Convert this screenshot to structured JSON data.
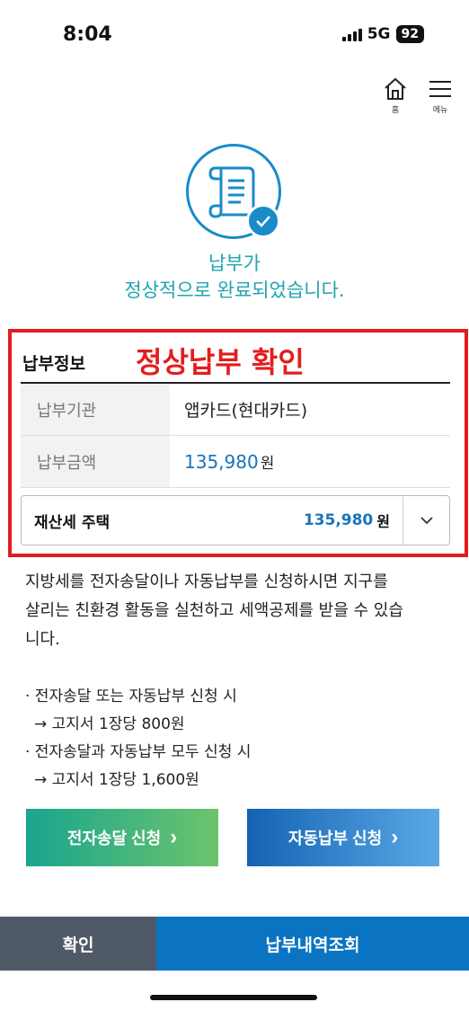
{
  "status": {
    "time": "8:04",
    "network": "5G",
    "battery": "92"
  },
  "nav": {
    "home_label": "홈",
    "menu_label": "메뉴"
  },
  "colors": {
    "accent": "#1a8bc9",
    "success_text": "#1fa3b2",
    "highlight_red": "#e31d1d",
    "amount_blue": "#1a74b8"
  },
  "hero": {
    "icon": "document-scroll-icon",
    "line1": "납부가",
    "line2": "정상적으로 완료되었습니다."
  },
  "info": {
    "title": "납부정보",
    "highlight": "정상납부 확인",
    "rows": [
      {
        "label": "납부기관",
        "value": "앱카드(현대카드)"
      },
      {
        "label": "납부금액",
        "amount": "135,980",
        "unit": "원"
      }
    ],
    "tax_item": {
      "name": "재산세 주택",
      "amount": "135,980",
      "unit": "원"
    }
  },
  "description": {
    "paragraph_line1": "지방세를 전자송달이나 자동납부를 신청하시면 지구를",
    "paragraph_line2": "살리는 친환경 활동을 실천하고 세액공제를 받을 수 있습",
    "paragraph_line3": "니다.",
    "bullet1": "· 전자송달 또는 자동납부 신청 시",
    "bullet1_sub": "→ 고지서 1장당 800원",
    "bullet2": "· 전자송달과 자동납부 모두 신청 시",
    "bullet2_sub": "→ 고지서 1장당 1,600원"
  },
  "actions": {
    "e_delivery": "전자송달 신청",
    "auto_pay": "자동납부 신청",
    "arrow": "›"
  },
  "bottom": {
    "confirm": "확인",
    "history": "납부내역조회"
  }
}
